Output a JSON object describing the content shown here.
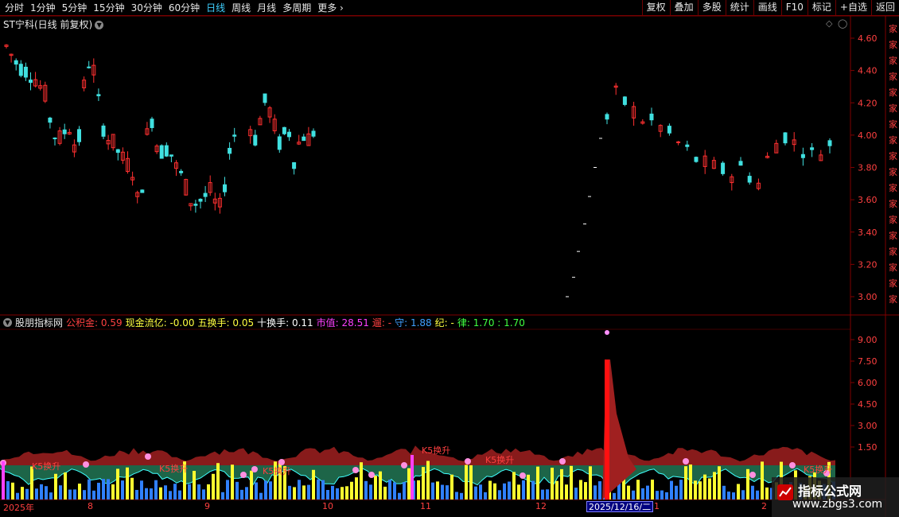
{
  "toolbar": {
    "periods": [
      "分时",
      "1分钟",
      "5分钟",
      "15分钟",
      "30分钟",
      "60分钟",
      "日线",
      "周线",
      "月线",
      "多周期",
      "更多"
    ],
    "active_period": "日线",
    "right_buttons": [
      "复权",
      "叠加",
      "多股",
      "统计",
      "画线",
      "F10",
      "标记",
      "+自选",
      "返回"
    ]
  },
  "main_chart": {
    "title": "ST宁科(日线 前复权)",
    "price_ticks": [
      "4.60",
      "4.40",
      "4.20",
      "4.00",
      "3.80",
      "3.60",
      "3.40",
      "3.20",
      "3.00"
    ]
  },
  "indicator": {
    "name": "股朋指标网",
    "fields": [
      {
        "label": "公积金:",
        "value": "0.59",
        "color": "#ff4040"
      },
      {
        "label": "现金流亿:",
        "value": "-0.00",
        "color": "#ffff40"
      },
      {
        "label": "五换手:",
        "value": "0.05",
        "color": "#ffff40"
      },
      {
        "label": "十换手:",
        "value": "0.11",
        "color": "#ffffff"
      },
      {
        "label": "市值:",
        "value": "28.51",
        "color": "#ff40ff"
      },
      {
        "label": "遛:",
        "value": "-",
        "color": "#ff4040"
      },
      {
        "label": "守:",
        "value": "1.88",
        "color": "#40a0ff"
      },
      {
        "label": "纪:",
        "value": "-",
        "color": "#ffff40"
      },
      {
        "label": "律:",
        "value": "1.70 : 1.70",
        "color": "#40ff40"
      }
    ],
    "ticks": [
      "9.00",
      "7.50",
      "6.00",
      "4.50",
      "3.00",
      "1.50"
    ],
    "annotations": [
      "K5换升",
      "K5换升",
      "K5换升",
      "K5换升",
      "K5换升",
      "K5换升"
    ]
  },
  "dates": {
    "labels": [
      "2025年",
      "8",
      "9",
      "10",
      "11",
      "12",
      "1",
      "2"
    ],
    "cursor": "2025/12/16/二"
  },
  "watermark": {
    "title": "指标公式网",
    "url": "www.zbgs3.com"
  },
  "colors": {
    "up": "#ff3030",
    "down": "#40e0e0",
    "axis": "#800000",
    "volume_yellow": "#ffff30",
    "volume_blue": "#3080ff",
    "area_red": "#a02020",
    "area_green": "#207050"
  }
}
